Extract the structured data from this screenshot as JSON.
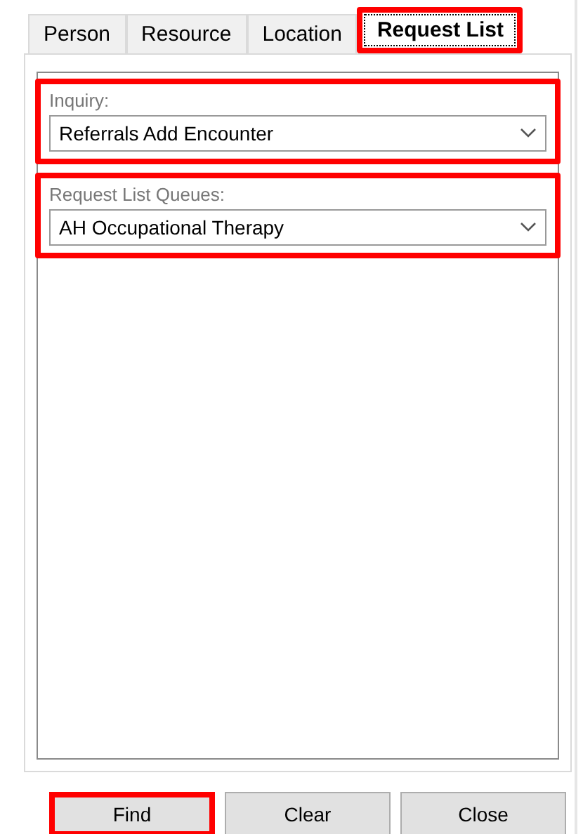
{
  "tabs": [
    {
      "label": "Person",
      "selected": false,
      "highlighted": false
    },
    {
      "label": "Resource",
      "selected": false,
      "highlighted": false
    },
    {
      "label": "Location",
      "selected": false,
      "highlighted": false
    },
    {
      "label": "Request List",
      "selected": true,
      "highlighted": true
    }
  ],
  "fields": [
    {
      "label": "Inquiry:",
      "value": "Referrals Add Encounter",
      "highlighted": true
    },
    {
      "label": "Request List Queues:",
      "value": "AH Occupational Therapy",
      "highlighted": true
    }
  ],
  "buttons": [
    {
      "label": "Find",
      "highlighted": true
    },
    {
      "label": "Clear",
      "highlighted": false
    },
    {
      "label": "Close",
      "highlighted": false
    }
  ]
}
